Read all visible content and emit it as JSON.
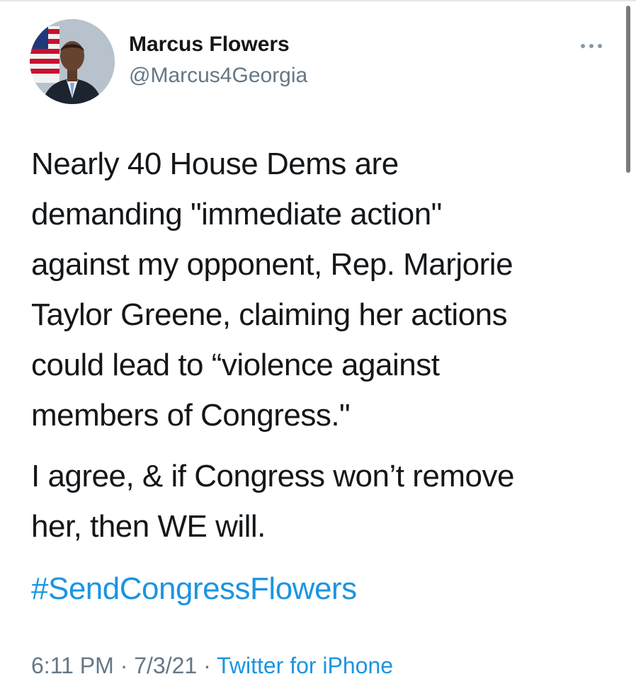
{
  "author": {
    "name": "Marcus Flowers",
    "handle": "@Marcus4Georgia"
  },
  "tweet": {
    "line1": "Nearly 40 House Dems are",
    "line2": "demanding \"immediate action\"",
    "line3": "against my opponent, Rep. Marjorie",
    "line4": "Taylor Greene, claiming her actions",
    "line5": "could lead to “violence against",
    "line6": "members of Congress.\"",
    "para2_line1": "I agree, & if Congress won’t remove",
    "para2_line2": "her, then WE will.",
    "hashtag": "#SendCongressFlowers"
  },
  "meta": {
    "time": "6:11 PM",
    "separator": " · ",
    "date": "7/3/21",
    "source": "Twitter for iPhone"
  },
  "icons": {
    "more": "more-horizontal-icon",
    "avatar": "profile-photo"
  },
  "colors": {
    "link": "#1b95e0",
    "text": "#14171a",
    "secondary": "#657786"
  }
}
